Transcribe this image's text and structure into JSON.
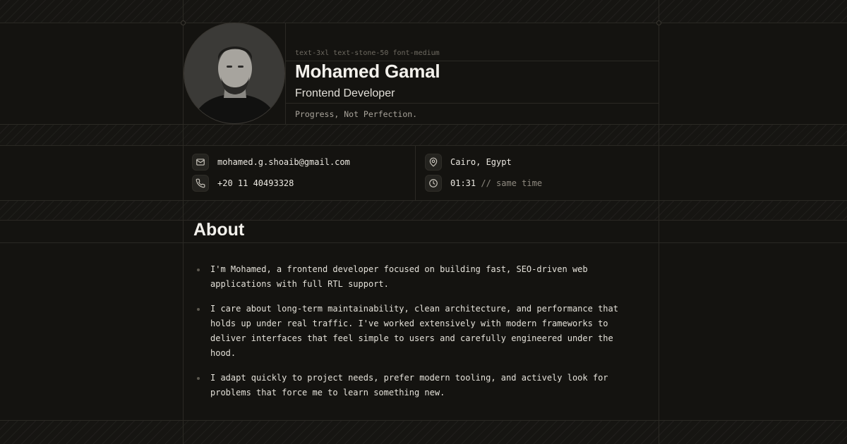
{
  "profile": {
    "hint": "text-3xl text-stone-50 font-medium",
    "name": "Mohamed Gamal",
    "role": "Frontend Developer",
    "tagline": "Progress, Not Perfection."
  },
  "contact": {
    "email": "mohamed.g.shoaib@gmail.com",
    "phone": "+20 11 40493328",
    "location": "Cairo, Egypt",
    "time": "01:31",
    "time_note": "// same time"
  },
  "icons": {
    "email": "mail-icon",
    "phone": "phone-icon",
    "location": "map-pin-icon",
    "time": "clock-icon"
  },
  "about": {
    "title": "About",
    "items": [
      "I'm Mohamed, a frontend developer focused on building fast, SEO-driven web applications with full RTL support.",
      "I care about long-term maintainability, clean architecture, and performance that holds up under real traffic. I've worked extensively with modern frameworks to deliver interfaces that feel simple to users and carefully engineered under the hood.",
      "I adapt quickly to project needs, prefer modern tooling, and actively look for problems that force me to learn something new."
    ]
  },
  "colors": {
    "background": "#141310",
    "text": "#f3f1ec",
    "muted": "#8f8a80",
    "grid": "#2b2924"
  }
}
